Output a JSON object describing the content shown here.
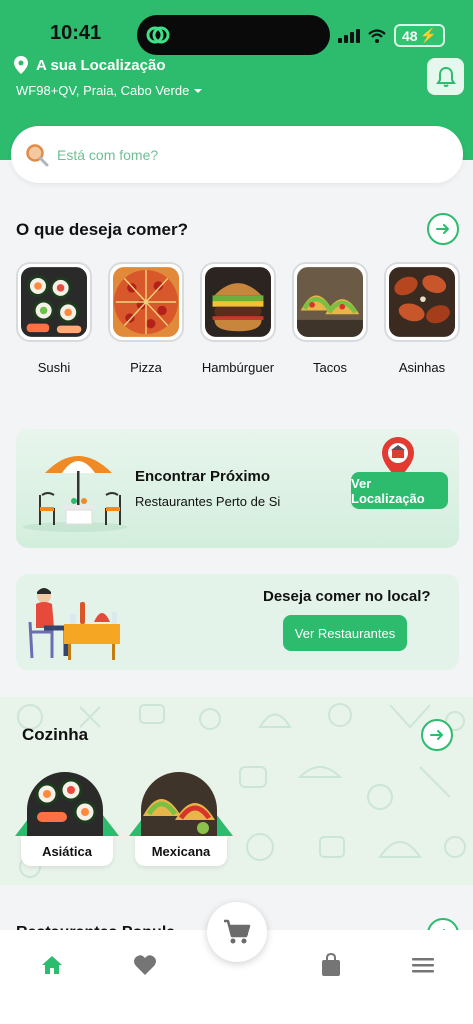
{
  "status_bar": {
    "time": "10:41",
    "battery": "48"
  },
  "header": {
    "location_title": "A sua Localização",
    "address": "WF98+QV, Praia, Cabo Verde"
  },
  "search": {
    "placeholder": "Está com fome?"
  },
  "categories": {
    "title": "O que deseja comer?",
    "items": [
      {
        "label": "Sushi",
        "icon": "sushi-image"
      },
      {
        "label": "Pizza",
        "icon": "pizza-image"
      },
      {
        "label": "Hambúrguer",
        "icon": "burger-image"
      },
      {
        "label": "Tacos",
        "icon": "tacos-image"
      },
      {
        "label": "Asinhas",
        "icon": "wings-image"
      }
    ]
  },
  "nearby_card": {
    "title": "Encontrar Próximo",
    "subtitle": "Restaurantes Perto de Si",
    "button": "Ver Localização"
  },
  "dine_in_card": {
    "title": "Deseja comer no local?",
    "button": "Ver Restaurantes"
  },
  "kitchen": {
    "title": "Cozinha",
    "items": [
      {
        "label": "Asiática"
      },
      {
        "label": "Mexicana"
      }
    ]
  },
  "next_section": {
    "title": "Restaurantes Popula"
  },
  "bottom_nav": {
    "items": [
      "home-icon",
      "heart-icon",
      "cart-icon",
      "bag-icon",
      "menu-icon"
    ]
  },
  "colors": {
    "brand": "#2dbb6e",
    "brand_light": "#e4f3ea"
  }
}
